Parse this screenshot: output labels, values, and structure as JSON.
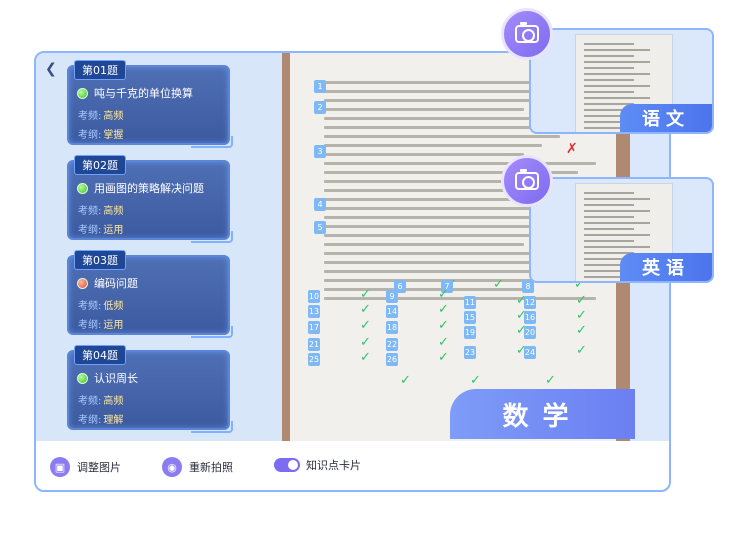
{
  "questions": [
    {
      "tag": "第01题",
      "title": "吨与千克的单位换算",
      "status": "green",
      "meta1_label": "考频:",
      "meta1_value": "高频",
      "meta2_label": "考纲:",
      "meta2_value": "掌握"
    },
    {
      "tag": "第02题",
      "title": "用画图的策略解决问题",
      "status": "green",
      "meta1_label": "考频:",
      "meta1_value": "高频",
      "meta2_label": "考纲:",
      "meta2_value": "运用"
    },
    {
      "tag": "第03题",
      "title": "编码问题",
      "status": "red",
      "meta1_label": "考频:",
      "meta1_value": "低频",
      "meta2_label": "考纲:",
      "meta2_value": "运用"
    },
    {
      "tag": "第04题",
      "title": "认识周长",
      "status": "green",
      "meta1_label": "考频:",
      "meta1_value": "高频",
      "meta2_label": "考纲:",
      "meta2_value": "理解"
    }
  ],
  "toolbar": {
    "adjust_label": "调整图片",
    "retake_label": "重新拍照",
    "cards_label": "知识点卡片",
    "cards_toggle_on": true
  },
  "subjects": {
    "main": "数学",
    "chinese": "语文",
    "english": "英语"
  },
  "paper": {
    "question_numbers": [
      "1",
      "2",
      "3",
      "4",
      "5",
      "6",
      "7",
      "8",
      "9",
      "10",
      "11",
      "12",
      "13",
      "14",
      "15",
      "16",
      "17",
      "18",
      "19",
      "20",
      "21",
      "22",
      "23",
      "24",
      "25",
      "26"
    ]
  },
  "icons": {
    "back": "chevron-left-icon",
    "crop": "crop-icon",
    "camera": "camera-icon",
    "toggle": "toggle-switch"
  },
  "colors": {
    "accent": "#7d6cf0",
    "card_bg": "#3c5aa0",
    "check": "#2ec46a",
    "subject_tab": "#6b7ff2"
  }
}
